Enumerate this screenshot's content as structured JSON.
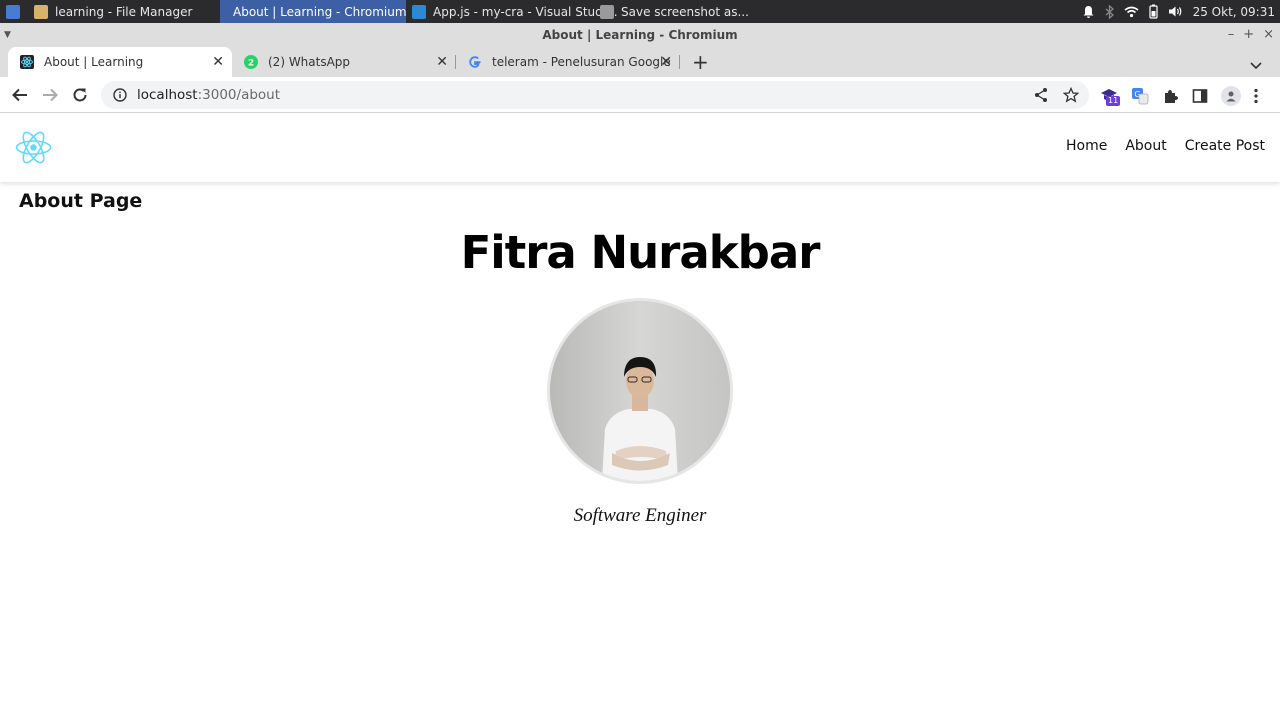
{
  "taskbar": {
    "items": [
      {
        "label": "learning - File Manager",
        "icon": "folder-icon"
      },
      {
        "label": "About | Learning - Chromium",
        "icon": "chromium-icon"
      },
      {
        "label": "App.js - my-cra - Visual Studi...",
        "icon": "vscode-icon"
      },
      {
        "label": "Save screenshot as...",
        "icon": "screenshot-icon"
      }
    ],
    "clock": "25 Okt, 09:31"
  },
  "window": {
    "title": "About | Learning - Chromium"
  },
  "tabs": [
    {
      "label": "About | Learning",
      "icon": "react-favicon"
    },
    {
      "label": "(2) WhatsApp",
      "icon": "whatsapp-favicon",
      "badge": "2"
    },
    {
      "label": "teleram - Penelusuran Google",
      "icon": "google-favicon"
    }
  ],
  "omnibox": {
    "host": "localhost",
    "path": ":3000/about"
  },
  "extensions": {
    "badge_count": "11"
  },
  "site_nav": {
    "links": [
      "Home",
      "About",
      "Create Post"
    ]
  },
  "page": {
    "heading": "About Page",
    "name": "Fitra Nurakbar",
    "job_title": "Software Enginer"
  },
  "colors": {
    "react_accent": "#61dafb",
    "taskbar_bg": "#2b2b2e",
    "taskbar_active": "#3d5fa6"
  }
}
